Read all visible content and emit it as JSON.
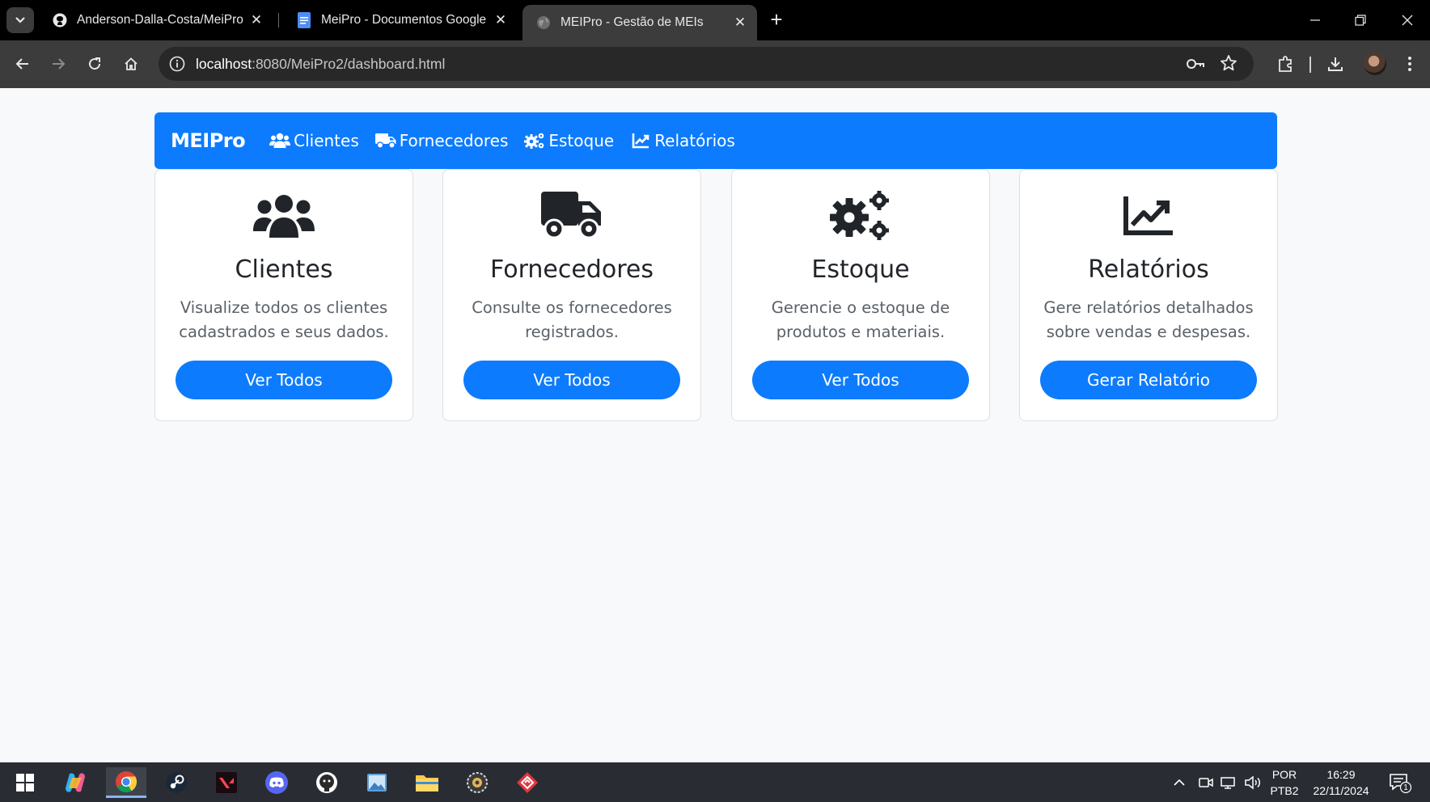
{
  "browser": {
    "tabs": [
      {
        "title": "Anderson-Dalla-Costa/MeiPro",
        "icon": "github-icon"
      },
      {
        "title": "MeiPro - Documentos Google",
        "icon": "google-docs-icon"
      },
      {
        "title": "MEIPro - Gestão de MEIs",
        "icon": "globe-icon",
        "active": true
      }
    ],
    "url_host": "localhost",
    "url_rest": ":8080/MeiPro2/dashboard.html"
  },
  "navbar": {
    "brand": "MEIPro",
    "links": [
      {
        "label": "Clientes",
        "icon": "users-icon"
      },
      {
        "label": "Fornecedores",
        "icon": "truck-icon"
      },
      {
        "label": "Estoque",
        "icon": "cogs-icon"
      },
      {
        "label": "Relatórios",
        "icon": "chart-line-icon"
      }
    ]
  },
  "cards": [
    {
      "title": "Clientes",
      "text": "Visualize todos os clientes cadastrados e seus dados.",
      "button": "Ver Todos",
      "icon": "users-icon"
    },
    {
      "title": "Fornecedores",
      "text": "Consulte os fornecedores registrados.",
      "button": "Ver Todos",
      "icon": "truck-icon"
    },
    {
      "title": "Estoque",
      "text": "Gerencie o estoque de produtos e materiais.",
      "button": "Ver Todos",
      "icon": "cogs-icon"
    },
    {
      "title": "Relatórios",
      "text": "Gere relatórios detalhados sobre vendas e despesas.",
      "button": "Gerar Relatório",
      "icon": "chart-line-icon"
    }
  ],
  "taskbar": {
    "lang_top": "POR",
    "lang_bottom": "PTB2",
    "time": "16:29",
    "date": "22/11/2024",
    "notification_count": "1"
  },
  "colors": {
    "primary": "#0d7bfd",
    "page_bg": "#f8f9fa",
    "icon_dark": "#212529"
  }
}
